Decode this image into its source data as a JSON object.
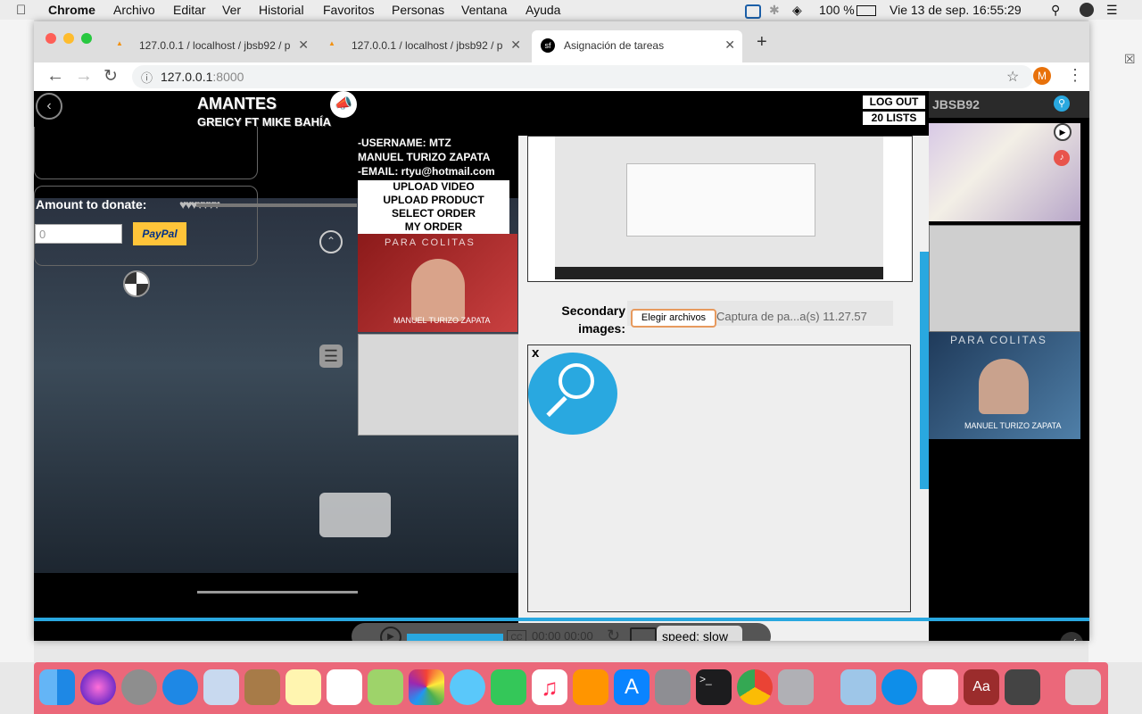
{
  "menubar": {
    "app": "Chrome",
    "items": [
      "Archivo",
      "Editar",
      "Ver",
      "Historial",
      "Favoritos",
      "Personas",
      "Ventana",
      "Ayuda"
    ],
    "battery": "100 %",
    "clock": "Vie 13 de sep.  16:55:29"
  },
  "browser": {
    "tabs": [
      {
        "title": "127.0.0.1 / localhost / jbsb92 / p",
        "favicon": "PMA"
      },
      {
        "title": "127.0.0.1 / localhost / jbsb92 / p",
        "favicon": "PMA"
      },
      {
        "title": "Asignación de tareas",
        "favicon": "sf"
      }
    ],
    "url_host": "127.0.0.1",
    "url_port": ":8000",
    "profile_initial": "M"
  },
  "player": {
    "song_title": "AMANTES",
    "artist": "GREICY FT MIKE BAHÍA",
    "donate_label": "Amount to donate:",
    "donate_value": "0",
    "paypal_label": "PayPal",
    "time_display": "00:00 00:00",
    "speed_label": "speed: slow"
  },
  "header": {
    "logout_label": "LOG OUT",
    "lists_label": "20 LISTS",
    "username": "JBSB92"
  },
  "user_info": {
    "username_line": "-USERNAME: MTZ",
    "name_line": "MANUEL TURIZO ZAPATA",
    "email_line": "-EMAIL: rtyu@hotmail.com",
    "menu": [
      "UPLOAD VIDEO",
      "UPLOAD PRODUCT",
      "SELECT ORDER",
      "MY ORDER"
    ]
  },
  "album": {
    "title": "PARA COLITAS",
    "artist": "MANUEL TURIZO ZAPATA"
  },
  "form": {
    "secondary_label": "Secondary images:",
    "choose_files": "Elegir archivos",
    "file_name": "Captura de pa...a(s) 11.27.57",
    "close_x": "x"
  },
  "dock": {
    "icons": [
      "finder-icon",
      "siri-icon",
      "launchpad-icon",
      "safari-icon",
      "mail-icon",
      "contacts-icon",
      "notes-icon",
      "reminders-icon",
      "maps-icon",
      "photos-icon",
      "messages-icon",
      "facetime-icon",
      "music-icon",
      "books-icon",
      "appstore-icon",
      "systemprefs-icon",
      "terminal-icon",
      "chrome-icon",
      "preferences-icon",
      "virtualbox-icon",
      "teamviewer-icon",
      "textedit-icon",
      "dictionary-icon",
      "calculator-icon",
      "trash-icon"
    ]
  },
  "colors": {
    "accent": "#29a8e0",
    "dock": "#eb5a6e",
    "page_bg": "#000000"
  }
}
